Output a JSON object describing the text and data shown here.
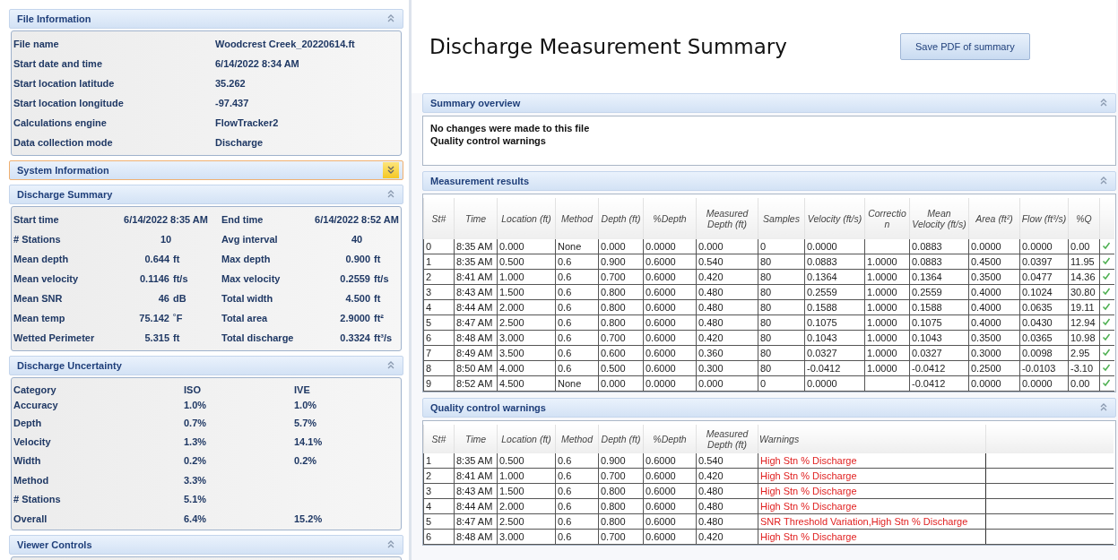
{
  "left_panel": {
    "sections": [
      {
        "title": "File Information",
        "expanded": true,
        "highlighted": false,
        "kind": "pairs",
        "rows": [
          {
            "label": "File name",
            "value": "Woodcrest Creek_20220614.ft"
          },
          {
            "label": "Start date and time",
            "value": "6/14/2022 8:34 AM"
          },
          {
            "label": "Start location latitude",
            "value": "35.262"
          },
          {
            "label": "Start location longitude",
            "value": "-97.437"
          },
          {
            "label": "Calculations engine",
            "value": "FlowTracker2"
          },
          {
            "label": "Data collection mode",
            "value": "Discharge"
          }
        ]
      },
      {
        "title": "System Information",
        "expanded": false,
        "highlighted": true
      },
      {
        "title": "Discharge Summary",
        "expanded": true,
        "highlighted": false,
        "kind": "summary",
        "rows": [
          {
            "label": "Start time",
            "value": "6/14/2022 8:35 AM",
            "label_2": "End time",
            "value_2": "6/14/2022 8:52 AM"
          },
          {
            "label": "# Stations",
            "value": "10",
            "label_2": "Avg interval",
            "value_2": "40"
          },
          {
            "label": "Mean depth",
            "value": "0.644",
            "unit": "ft",
            "label_2": "Max depth",
            "value_2": "0.900",
            "unit_2": "ft"
          },
          {
            "label": "Mean velocity",
            "value": "0.1146",
            "unit": "ft/s",
            "label_2": "Max velocity",
            "value_2": "0.2559",
            "unit_2": "ft/s"
          },
          {
            "label": "Mean SNR",
            "value": "46",
            "unit": "dB",
            "label_2": "Total width",
            "value_2": "4.500",
            "unit_2": "ft"
          },
          {
            "label": "Mean temp",
            "value": "75.142",
            "unit": "˚F",
            "label_2": "Total area",
            "value_2": "2.9000",
            "unit_2": "ft²"
          },
          {
            "label": "Wetted Perimeter",
            "value": "5.315",
            "unit": "ft",
            "label_2": "Total discharge",
            "value_2": "0.3324",
            "unit_2": "ft³/s"
          }
        ]
      },
      {
        "title": "Discharge Uncertainty",
        "expanded": true,
        "highlighted": false,
        "kind": "uncertainty",
        "columns": [
          "Category",
          "ISO",
          "IVE"
        ],
        "rows": [
          [
            "Accuracy",
            "1.0%",
            "1.0%"
          ],
          [
            "Depth",
            "0.7%",
            "5.7%"
          ],
          [
            "Velocity",
            "1.3%",
            "14.1%"
          ],
          [
            "Width",
            "0.2%",
            "0.2%"
          ],
          [
            "Method",
            "3.3%"
          ],
          [
            "# Stations",
            "5.1%"
          ],
          [
            "Overall",
            "6.4%",
            "15.2%"
          ]
        ]
      },
      {
        "title": "Viewer Controls",
        "expanded": true,
        "highlighted": false
      }
    ]
  },
  "main": {
    "title": "Discharge Measurement Summary",
    "save_button": "Save PDF of summary",
    "sections": [
      {
        "title": "Summary overview",
        "expanded": true,
        "kind": "text",
        "lines": [
          "No changes were made to this file",
          "Quality control warnings"
        ]
      },
      {
        "title": "Measurement results",
        "expanded": true,
        "kind": "results",
        "columns": [
          "St#",
          "Time",
          "Location (ft)",
          "Method",
          "Depth (ft)",
          "%Depth",
          "Measured Depth (ft)",
          "Samples",
          "Velocity (ft/s)",
          "Correction",
          "Mean Velocity (ft/s)",
          "Area (ft²)",
          "Flow (ft³/s)",
          "%Q"
        ],
        "rows": [
          {
            "cells": [
              "0",
              "8:35 AM",
              "0.000",
              "None",
              "0.000",
              "0.0000",
              "0.000",
              "0",
              "0.0000",
              "",
              "0.0883",
              "0.0000",
              "0.0000",
              "0.00"
            ],
            "valid": true
          },
          {
            "cells": [
              "1",
              "8:35 AM",
              "0.500",
              "0.6",
              "0.900",
              "0.6000",
              "0.540",
              "80",
              "0.0883",
              "1.0000",
              "0.0883",
              "0.4500",
              "0.0397",
              "11.95"
            ],
            "valid": true
          },
          {
            "cells": [
              "2",
              "8:41 AM",
              "1.000",
              "0.6",
              "0.700",
              "0.6000",
              "0.420",
              "80",
              "0.1364",
              "1.0000",
              "0.1364",
              "0.3500",
              "0.0477",
              "14.36"
            ],
            "valid": true
          },
          {
            "cells": [
              "3",
              "8:43 AM",
              "1.500",
              "0.6",
              "0.800",
              "0.6000",
              "0.480",
              "80",
              "0.2559",
              "1.0000",
              "0.2559",
              "0.4000",
              "0.1024",
              "30.80"
            ],
            "valid": true
          },
          {
            "cells": [
              "4",
              "8:44 AM",
              "2.000",
              "0.6",
              "0.800",
              "0.6000",
              "0.480",
              "80",
              "0.1588",
              "1.0000",
              "0.1588",
              "0.4000",
              "0.0635",
              "19.11"
            ],
            "valid": true
          },
          {
            "cells": [
              "5",
              "8:47 AM",
              "2.500",
              "0.6",
              "0.800",
              "0.6000",
              "0.480",
              "80",
              "0.1075",
              "1.0000",
              "0.1075",
              "0.4000",
              "0.0430",
              "12.94"
            ],
            "valid": true
          },
          {
            "cells": [
              "6",
              "8:48 AM",
              "3.000",
              "0.6",
              "0.700",
              "0.6000",
              "0.420",
              "80",
              "0.1043",
              "1.0000",
              "0.1043",
              "0.3500",
              "0.0365",
              "10.98"
            ],
            "valid": true
          },
          {
            "cells": [
              "7",
              "8:49 AM",
              "3.500",
              "0.6",
              "0.600",
              "0.6000",
              "0.360",
              "80",
              "0.0327",
              "1.0000",
              "0.0327",
              "0.3000",
              "0.0098",
              "2.95"
            ],
            "valid": true
          },
          {
            "cells": [
              "8",
              "8:50 AM",
              "4.000",
              "0.6",
              "0.500",
              "0.6000",
              "0.300",
              "80",
              "-0.0412",
              "1.0000",
              "-0.0412",
              "0.2500",
              "-0.0103",
              "-3.10"
            ],
            "valid": true
          },
          {
            "cells": [
              "9",
              "8:52 AM",
              "4.500",
              "None",
              "0.000",
              "0.0000",
              "0.000",
              "0",
              "0.0000",
              "",
              "-0.0412",
              "0.0000",
              "0.0000",
              "0.00"
            ],
            "valid": true
          }
        ]
      },
      {
        "title": "Quality control warnings",
        "expanded": true,
        "kind": "warnings",
        "columns": [
          "St#",
          "Time",
          "Location (ft)",
          "Method",
          "Depth (ft)",
          "%Depth",
          "Measured Depth (ft)",
          "Warnings"
        ],
        "rows": [
          {
            "cells": [
              "1",
              "8:35 AM",
              "0.500",
              "0.6",
              "0.900",
              "0.6000",
              "0.540"
            ],
            "warning": "High Stn % Discharge"
          },
          {
            "cells": [
              "2",
              "8:41 AM",
              "1.000",
              "0.6",
              "0.700",
              "0.6000",
              "0.420"
            ],
            "warning": "High Stn % Discharge"
          },
          {
            "cells": [
              "3",
              "8:43 AM",
              "1.500",
              "0.6",
              "0.800",
              "0.6000",
              "0.480"
            ],
            "warning": "High Stn % Discharge"
          },
          {
            "cells": [
              "4",
              "8:44 AM",
              "2.000",
              "0.6",
              "0.800",
              "0.6000",
              "0.480"
            ],
            "warning": "High Stn % Discharge"
          },
          {
            "cells": [
              "5",
              "8:47 AM",
              "2.500",
              "0.6",
              "0.800",
              "0.6000",
              "0.480"
            ],
            "warning": "SNR Threshold Variation,High Stn % Discharge"
          },
          {
            "cells": [
              "6",
              "8:48 AM",
              "3.000",
              "0.6",
              "0.700",
              "0.6000",
              "0.420"
            ],
            "warning": "High Stn % Discharge"
          }
        ]
      }
    ]
  }
}
